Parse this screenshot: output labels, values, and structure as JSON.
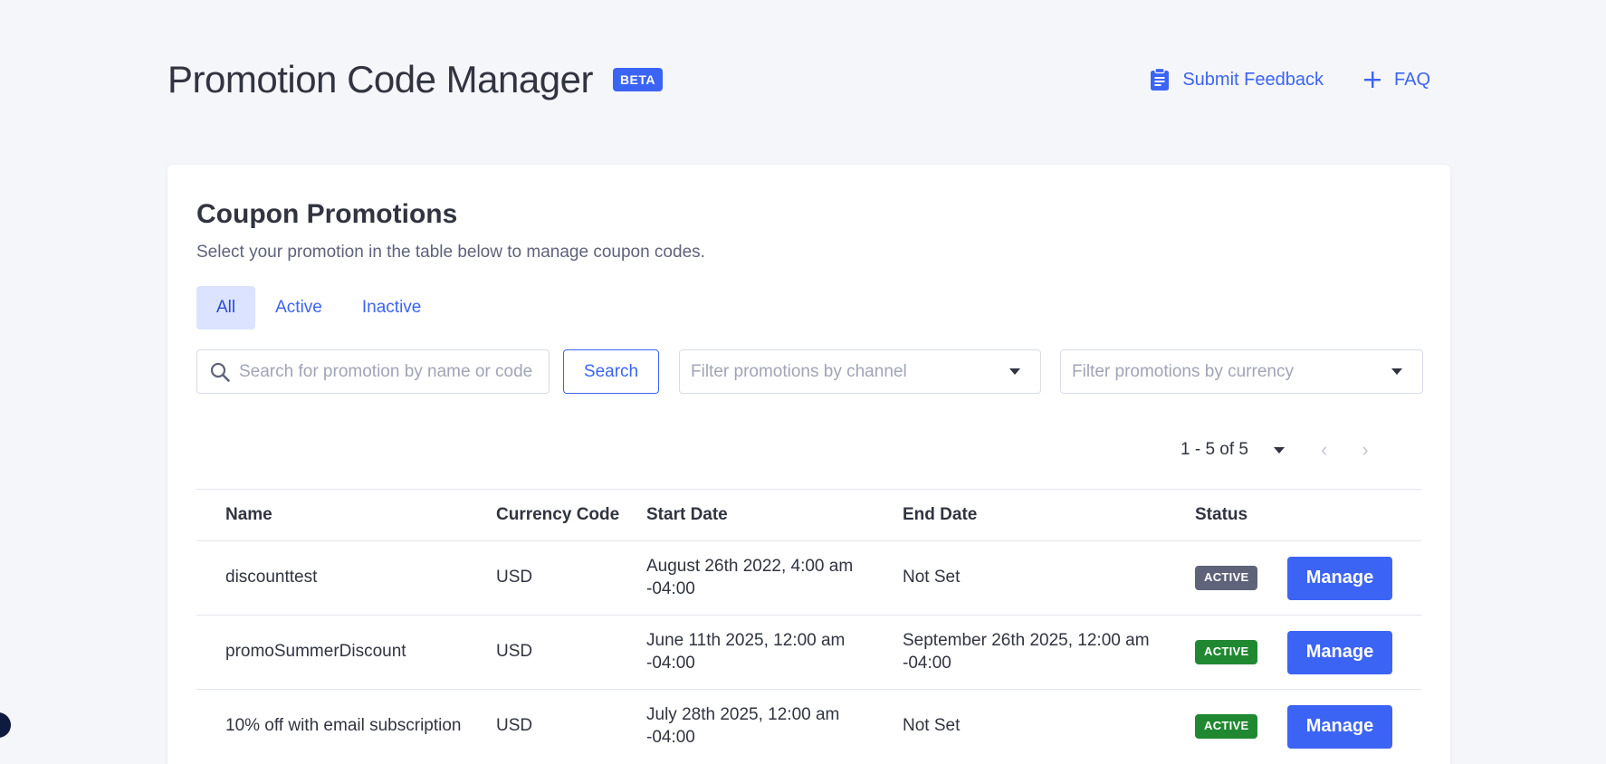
{
  "header": {
    "title": "Promotion Code Manager",
    "beta_label": "BETA",
    "feedback_label": "Submit Feedback",
    "faq_label": "FAQ"
  },
  "card": {
    "title": "Coupon Promotions",
    "subtitle": "Select your promotion in the table below to manage coupon codes."
  },
  "tabs": [
    {
      "label": "All",
      "active": true
    },
    {
      "label": "Active",
      "active": false
    },
    {
      "label": "Inactive",
      "active": false
    }
  ],
  "filters": {
    "search_placeholder": "Search for promotion by name or code",
    "search_button": "Search",
    "channel_placeholder": "Filter promotions by channel",
    "currency_placeholder": "Filter promotions by currency"
  },
  "pagination": {
    "range_text": "1 - 5 of 5"
  },
  "table": {
    "columns": [
      "Name",
      "Currency Code",
      "Start Date",
      "End Date",
      "Status"
    ],
    "rows": [
      {
        "name": "discounttest",
        "currency": "USD",
        "start_line1": "August 26th 2022, 4:00 am",
        "start_line2": "-04:00",
        "end_line1": "Not Set",
        "end_line2": "",
        "status": "ACTIVE",
        "status_color": "#5e637a",
        "action": "Manage"
      },
      {
        "name": "promoSummerDiscount",
        "currency": "USD",
        "start_line1": "June 11th 2025, 12:00 am",
        "start_line2": "-04:00",
        "end_line1": "September 26th 2025, 12:00 am",
        "end_line2": "-04:00",
        "status": "ACTIVE",
        "status_color": "#208831",
        "action": "Manage"
      },
      {
        "name": "10% off with email subscription",
        "currency": "USD",
        "start_line1": "July 28th 2025, 12:00 am",
        "start_line2": "-04:00",
        "end_line1": "Not Set",
        "end_line2": "",
        "status": "ACTIVE",
        "status_color": "#208831",
        "action": "Manage"
      }
    ]
  },
  "colors": {
    "accent": "#3c64f4",
    "background": "#f5f6fa",
    "active_green": "#208831",
    "active_grey": "#5e637a"
  }
}
